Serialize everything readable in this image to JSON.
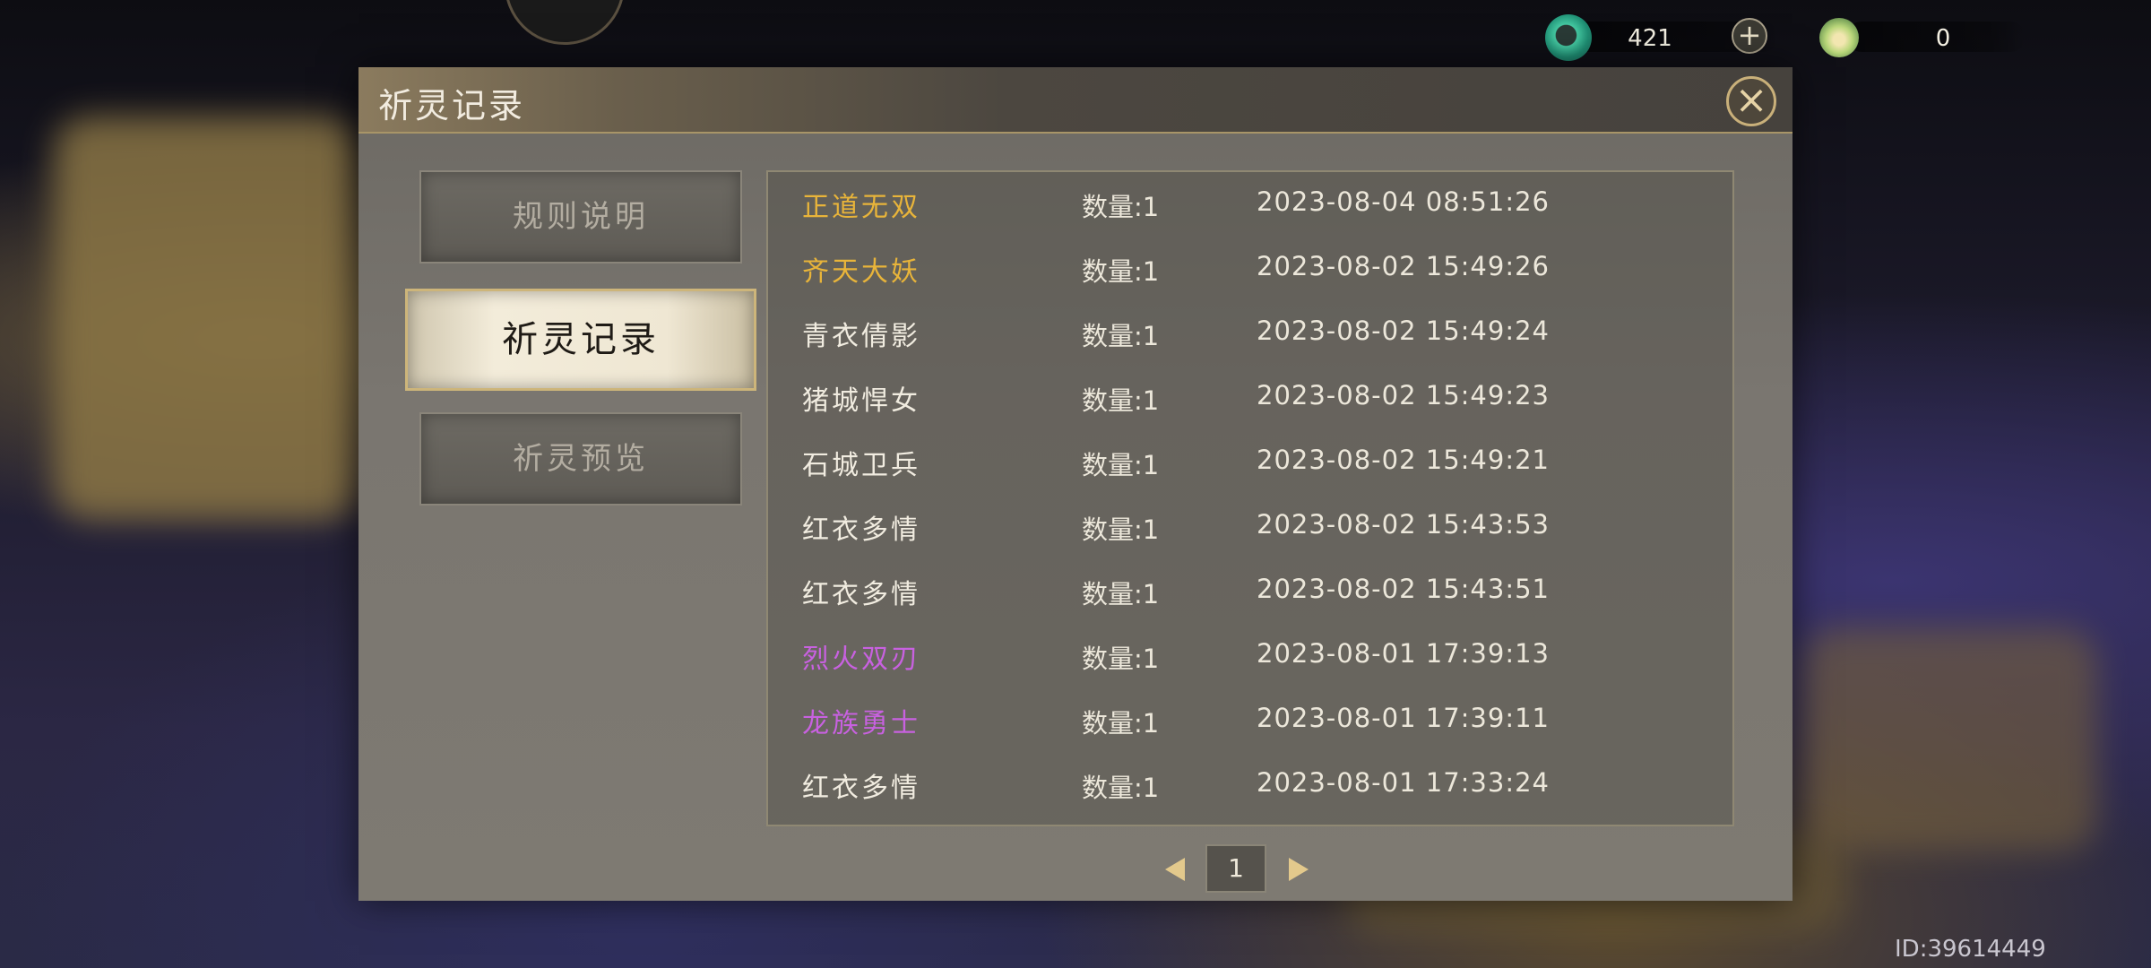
{
  "hud": {
    "resource1": {
      "icon": "jade-dragon-icon",
      "value": "421",
      "plus": "+"
    },
    "resource2": {
      "icon": "lotus-gem-icon",
      "value": "0"
    }
  },
  "dialog": {
    "title": "祈灵记录",
    "close": "×",
    "tabs": [
      {
        "label": "规则说明",
        "active": false
      },
      {
        "label": "祈灵记录",
        "active": true
      },
      {
        "label": "祈灵预览",
        "active": false
      }
    ],
    "records": [
      {
        "name": "正道无双",
        "qty": "数量:1",
        "time": "2023-08-04 08:51:26",
        "color": "#e8b43a"
      },
      {
        "name": "齐天大妖",
        "qty": "数量:1",
        "time": "2023-08-02 15:49:26",
        "color": "#e8b43a"
      },
      {
        "name": "青衣倩影",
        "qty": "数量:1",
        "time": "2023-08-02 15:49:24",
        "color": "#f1ece0"
      },
      {
        "name": "猪城悍女",
        "qty": "数量:1",
        "time": "2023-08-02 15:49:23",
        "color": "#f1ece0"
      },
      {
        "name": "石城卫兵",
        "qty": "数量:1",
        "time": "2023-08-02 15:49:21",
        "color": "#f1ece0"
      },
      {
        "name": "红衣多情",
        "qty": "数量:1",
        "time": "2023-08-02 15:43:53",
        "color": "#f1ece0"
      },
      {
        "name": "红衣多情",
        "qty": "数量:1",
        "time": "2023-08-02 15:43:51",
        "color": "#f1ece0"
      },
      {
        "name": "烈火双刃",
        "qty": "数量:1",
        "time": "2023-08-01 17:39:13",
        "color": "#c861e0"
      },
      {
        "name": "龙族勇士",
        "qty": "数量:1",
        "time": "2023-08-01 17:39:11",
        "color": "#c861e0"
      },
      {
        "name": "红衣多情",
        "qty": "数量:1",
        "time": "2023-08-01 17:33:24",
        "color": "#f1ece0"
      }
    ],
    "pager": {
      "page": "1"
    }
  },
  "footer": {
    "user_id": "ID:39614449"
  }
}
